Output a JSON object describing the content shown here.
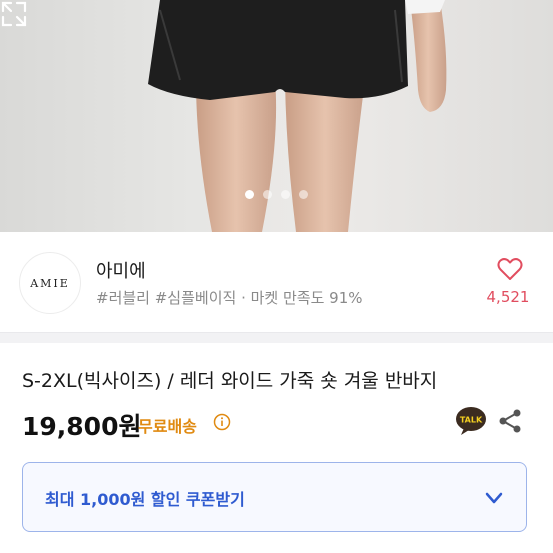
{
  "gallery": {
    "slide_count": 4,
    "active_index": 0
  },
  "shop": {
    "logo_text": "AMIE",
    "name": "아미에",
    "tags": "#러블리 #심플베이직 · 마켓 만족도 91%",
    "likes": "4,521"
  },
  "product": {
    "title": "S-2XL(빅사이즈) / 레더 와이드 가죽 숏 겨울 반바지",
    "price": "19,800원",
    "shipping": "무료배송",
    "talk_label": "TALK"
  },
  "coupon": {
    "label": "최대 1,000원 할인 쿠폰받기"
  },
  "colors": {
    "accent_blue": "#2f5bd0",
    "like_red": "#e14d5f",
    "shipping_orange": "#e08a11"
  }
}
